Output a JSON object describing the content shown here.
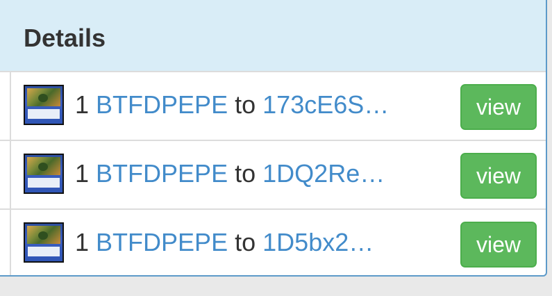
{
  "panel": {
    "title": "Details"
  },
  "rows": [
    {
      "qty": "1",
      "asset": "BTFDPEPE",
      "sep": "to",
      "address": "173cE6S…",
      "button": "view"
    },
    {
      "qty": "1",
      "asset": "BTFDPEPE",
      "sep": "to",
      "address": "1DQ2Re…",
      "button": "view"
    },
    {
      "qty": "1",
      "asset": "BTFDPEPE",
      "sep": "to",
      "address": "1D5bx2…",
      "button": "view"
    }
  ],
  "colors": {
    "header_bg": "#d9edf7",
    "link": "#428bca",
    "button": "#5cb85c",
    "border": "#5d9ac9"
  }
}
